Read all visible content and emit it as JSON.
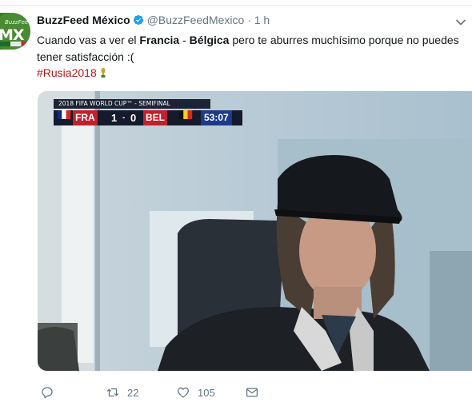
{
  "tweet": {
    "display_name": "BuzzFeed México",
    "handle": "@BuzzFeedMexico",
    "separator": "·",
    "time": "1 h",
    "text_part1": "Cuando vas a ver el ",
    "text_bold1": "Francia",
    "text_part2": " - ",
    "text_bold2": "Bélgica",
    "text_part3": " pero te aburres muchísimo porque no puedes tener satisfacción :(",
    "hashtag": "#Rusia2018",
    "avatar": {
      "small_text": "BuzzFeed",
      "big_text": "MX"
    }
  },
  "media": {
    "scoreboard": {
      "header": "2018 FIFA WORLD CUP™ - SEMIFINAL",
      "team_home": "FRA",
      "score_home": "1",
      "score_sep": "-",
      "score_away": "0",
      "team_away": "BEL",
      "clock": "53:07"
    }
  },
  "actions": {
    "reply_icon": "reply-icon",
    "retweet_icon": "retweet-icon",
    "retweet_count": "22",
    "like_icon": "heart-icon",
    "like_count": "105",
    "dm_icon": "envelope-icon"
  },
  "colors": {
    "hashtag": "#b31b1b",
    "verified": "#1da1f2",
    "muted": "#657786"
  }
}
